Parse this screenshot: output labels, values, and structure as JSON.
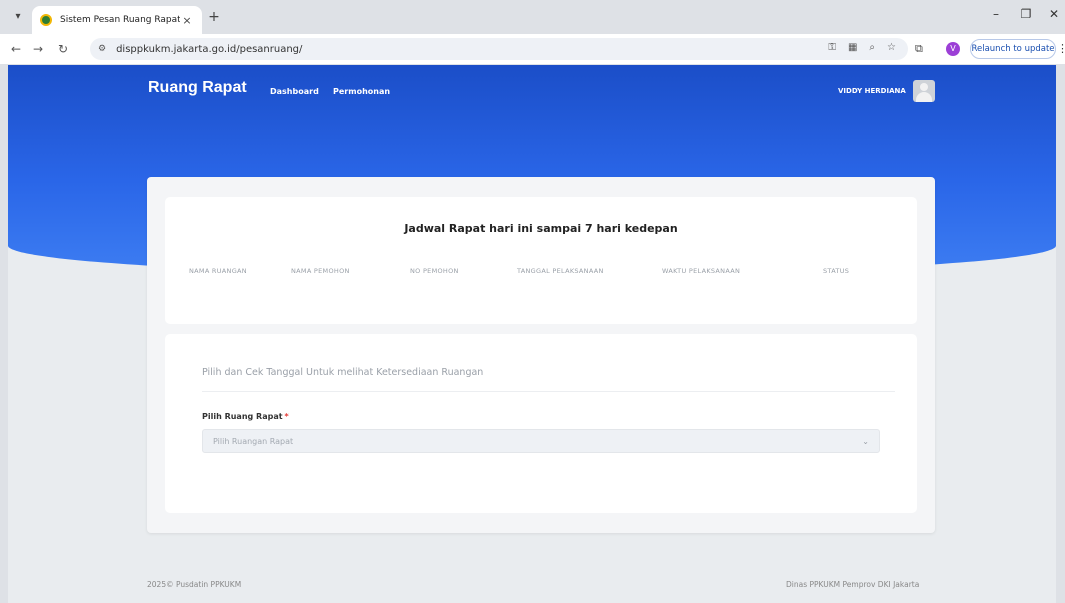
{
  "browser": {
    "tab_title": "Sistem Pesan Ruang Rapat",
    "tab_close": "×",
    "new_tab": "+",
    "url": "disppkukm.jakarta.go.id/pesanruang/",
    "relaunch_label": "Relaunch to update",
    "profile_initial": "V",
    "icons": [
      "back-icon",
      "forward-icon",
      "reload-icon",
      "site-info-icon",
      "password-key-icon",
      "translate-icon",
      "zoom-icon",
      "bookmark-star-icon",
      "extensions-icon",
      "menu-icon"
    ]
  },
  "header": {
    "brand": "Ruang Rapat",
    "nav": [
      "Dashboard",
      "Permohonan"
    ],
    "user": "VIDDY HERDIANA"
  },
  "schedule": {
    "title": "Jadwal Rapat hari ini sampai 7 hari kedepan",
    "columns": [
      "NAMA RUANGAN",
      "NAMA PEMOHON",
      "NO PEMOHON",
      "TANGGAL PELAKSANAAN",
      "WAKTU PELAKSANAAN",
      "STATUS"
    ]
  },
  "availability": {
    "subtitle": "Pilih dan Cek Tanggal Untuk melihat Ketersediaan Ruangan",
    "field_label": "Pilih Ruang Rapat",
    "required_mark": "*",
    "select_placeholder": "Pilih Ruangan Rapat"
  },
  "footer": {
    "left": "2025© Pusdatin PPKUKM",
    "right": "Dinas PPKUKM Pemprov DKI Jakarta"
  },
  "colors": {
    "hero": "#2a66e8",
    "accent_required": "#e53935"
  }
}
